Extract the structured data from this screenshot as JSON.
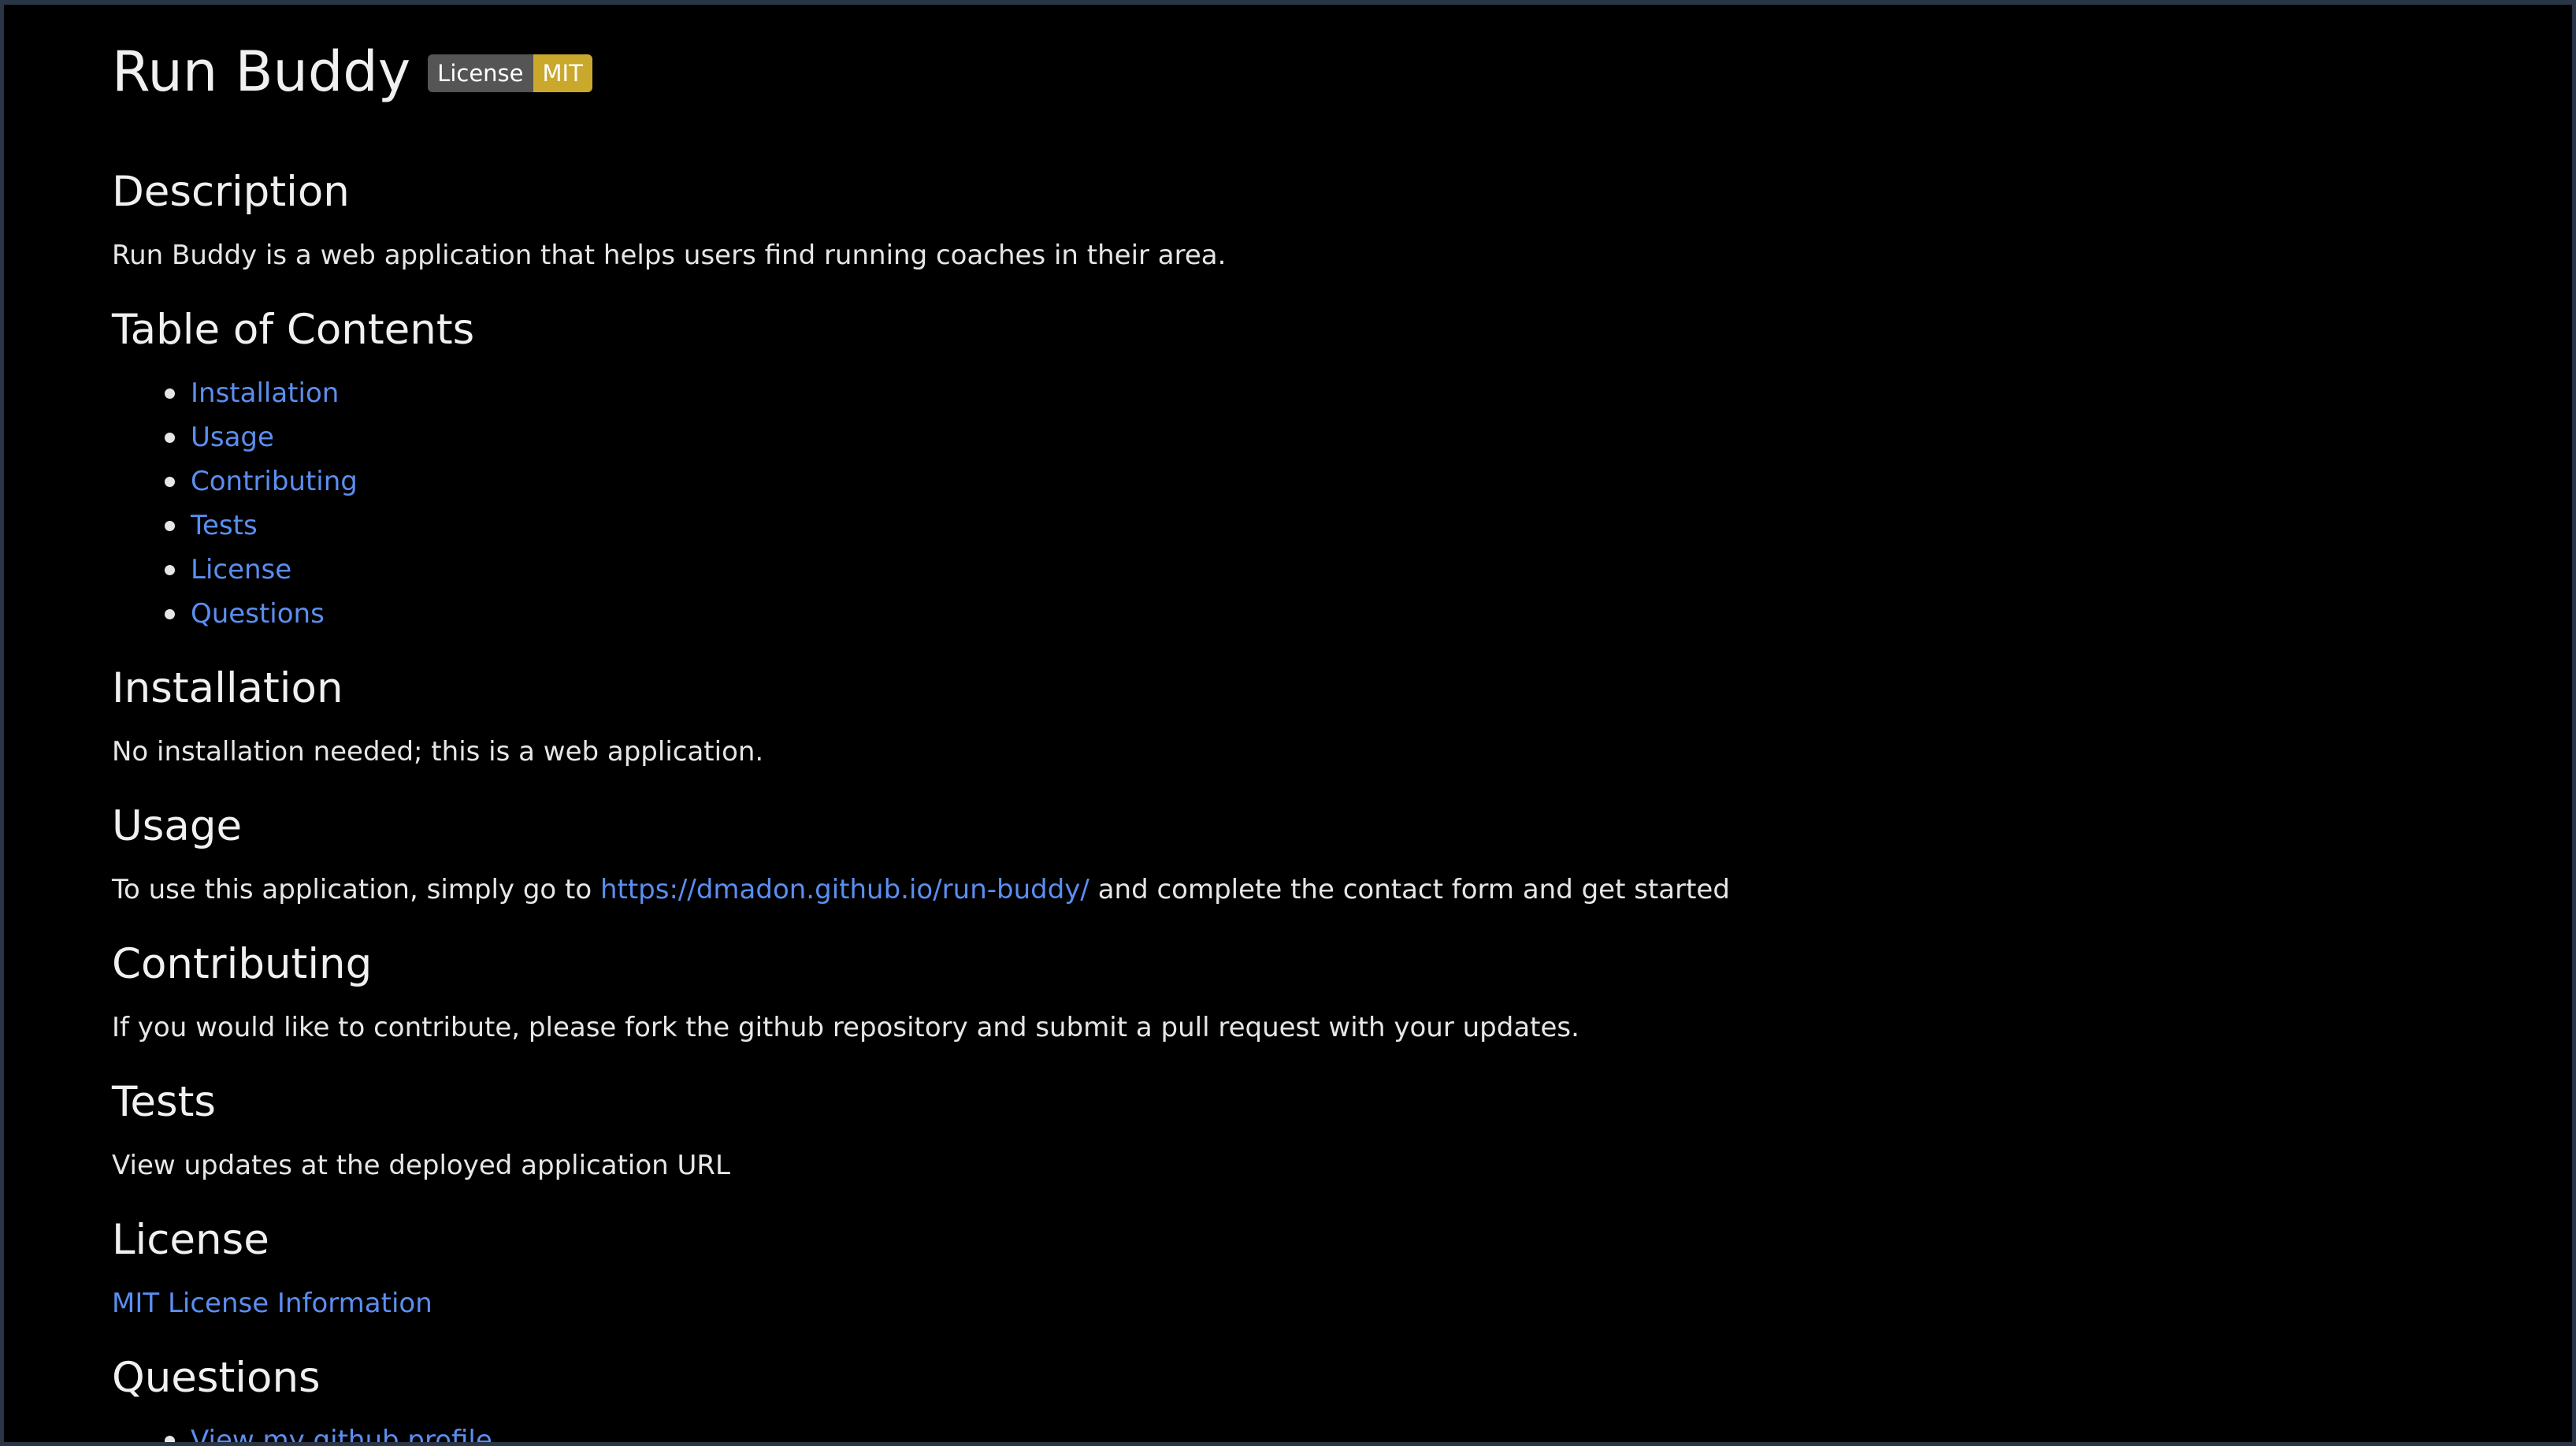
{
  "title": "Run Buddy",
  "badge": {
    "left": "License",
    "right": "MIT"
  },
  "description": {
    "heading": "Description",
    "text": "Run Buddy is a web application that helps users find running coaches in their area."
  },
  "toc": {
    "heading": "Table of Contents",
    "items": [
      "Installation",
      "Usage",
      "Contributing",
      "Tests",
      "License",
      "Questions"
    ]
  },
  "installation": {
    "heading": "Installation",
    "text": "No installation needed; this is a web application."
  },
  "usage": {
    "heading": "Usage",
    "text_before": "To use this application, simply go to ",
    "link": "https://dmadon.github.io/run-buddy/",
    "text_after": " and complete the contact form and get started"
  },
  "contributing": {
    "heading": "Contributing",
    "text": "If you would like to contribute, please fork the github repository and submit a pull request with your updates."
  },
  "tests": {
    "heading": "Tests",
    "text": "View updates at the deployed application URL"
  },
  "license": {
    "heading": "License",
    "link": "MIT License Information"
  },
  "questions": {
    "heading": "Questions",
    "items": [
      "View my github profile"
    ]
  },
  "colors": {
    "background": "#000000",
    "text": "#e6e6e6",
    "link": "#5b8ef0",
    "badge_left": "#555555",
    "badge_right": "#c9a82c"
  }
}
